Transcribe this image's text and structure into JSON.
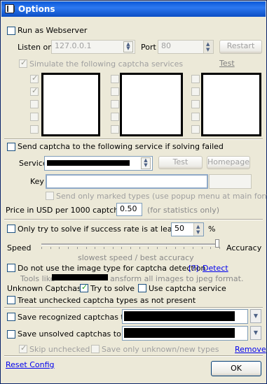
{
  "window": {
    "title": "Options"
  },
  "webserver": {
    "run_label": "Run as Webserver",
    "listen_label": "Listen on",
    "listen_value": "127.0.0.1",
    "port_label": "Port",
    "port_value": "80",
    "restart_label": "Restart",
    "simulate_label": "Simulate the following captcha services",
    "test_link": "Test"
  },
  "fallback": {
    "send_label": "Send captcha to the following service if solving failed",
    "service_label": "Service",
    "test_button": "Test",
    "homepage_button": "Homepage",
    "key_label": "Key",
    "key_value": "",
    "marked_label": "Send only marked types (use popup menu at main form)",
    "price_label": "Price in USD per 1000 captchas",
    "price_value": "0.50",
    "price_hint": "(for statistics only)"
  },
  "solving": {
    "rate_label": "Only try to solve if success rate is at least",
    "rate_value": "50",
    "rate_unit": "%",
    "speed_label": "Speed",
    "accuracy_label": "Accuracy",
    "slider_hint": "slowest speed / best accuracy",
    "slider_level": 1.0,
    "no_image_label": "Do not use the image type for captcha detection",
    "help_link": "[?]",
    "detect_link": "Detect",
    "tools_pre": "Tools like",
    "tools_post": "ansform all images to jpeg format.",
    "unknown_label": "Unknown Captchas:",
    "try_label": "Try to solve",
    "use_service_label": "Use captcha service",
    "treat_label": "Treat unchecked captcha types as not present"
  },
  "saving": {
    "recognized_label": "Save recognized captchas to",
    "unsolved_label": "Save unsolved captchas to",
    "skip_label": "Skip unchecked",
    "unknown_only_label": "Save only unknown/new types",
    "remove_link": "Remove"
  },
  "footer": {
    "reset_link": "Reset Config",
    "ok_label": "OK"
  },
  "colors": {
    "title_bar": "#0a58d8",
    "link": "#0000ee",
    "window_bg": "#ece9d8",
    "checkmark": "#21a121"
  }
}
